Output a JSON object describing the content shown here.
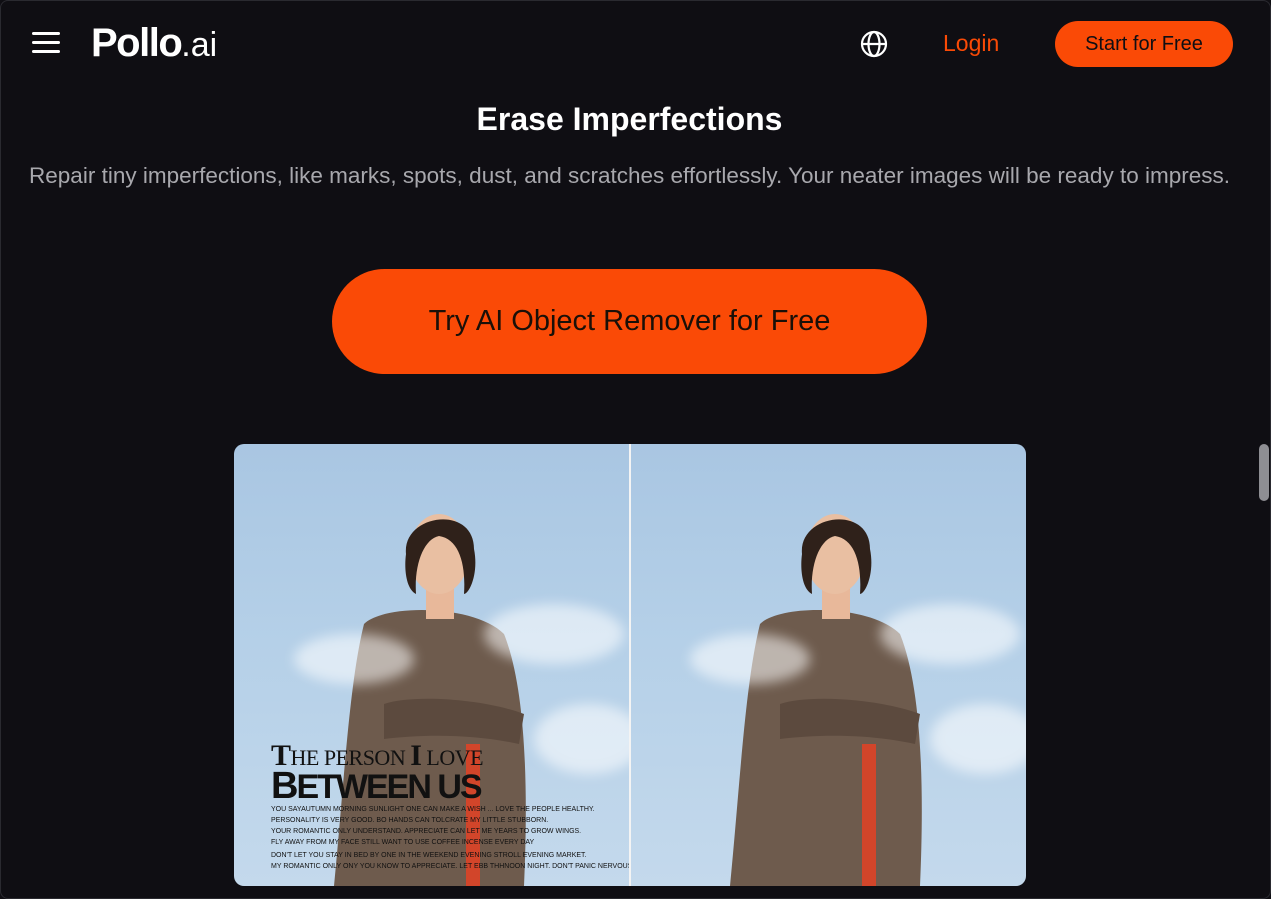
{
  "header": {
    "logo_main": "Pollo",
    "logo_suffix": ".ai",
    "login_label": "Login",
    "start_label": "Start for Free"
  },
  "hero": {
    "title": "Erase Imperfections",
    "description": "Repair tiny imperfections, like marks, spots, dust, and scratches effortlessly. Your neater images will be ready to impress.",
    "cta_label": "Try AI Object Remover for Free"
  },
  "comparison": {
    "overlay": {
      "line1_cap1": "T",
      "line1_rest1": "HE PERSON ",
      "line1_cap2": "I",
      "line1_rest2": " LOVE",
      "line2_cap": "B",
      "line2_rest": "ETWEEN US",
      "small": [
        "YOU SAYAUTUMN MORNING SUNLIGHT ONE CAN MAKE A WISH ... LOVE THE PEOPLE HEALTHY.",
        "PERSONALITY IS VERY GOOD. BO HANDS CAN TOLCRATE MY LITTLE STUBBORN.",
        "YOUR ROMANTIC ONLY UNDERSTAND. APPRECIATE CAN LET ME YEARS TO GROW WINGS.",
        "FLY AWAY FROM MY FACE STILL WANT TO USE COFFEE INCENSE EVERY DAY",
        "DON'T LET YOU STAY IN BED BY ONE IN THE WEEKEND EVENING STROLL EVENING MARKET.",
        "MY ROMANTIC ONLY ONY YOU KNOW TO APPRECIATE. LET EBB THHNOON NIGHT. DON'T PANIC NERVOUS."
      ]
    }
  },
  "colors": {
    "accent": "#fa4a06",
    "background": "#0f0e13",
    "muted_text": "#a8a8ad"
  },
  "icons": {
    "menu": "hamburger-icon",
    "language": "globe-icon"
  }
}
